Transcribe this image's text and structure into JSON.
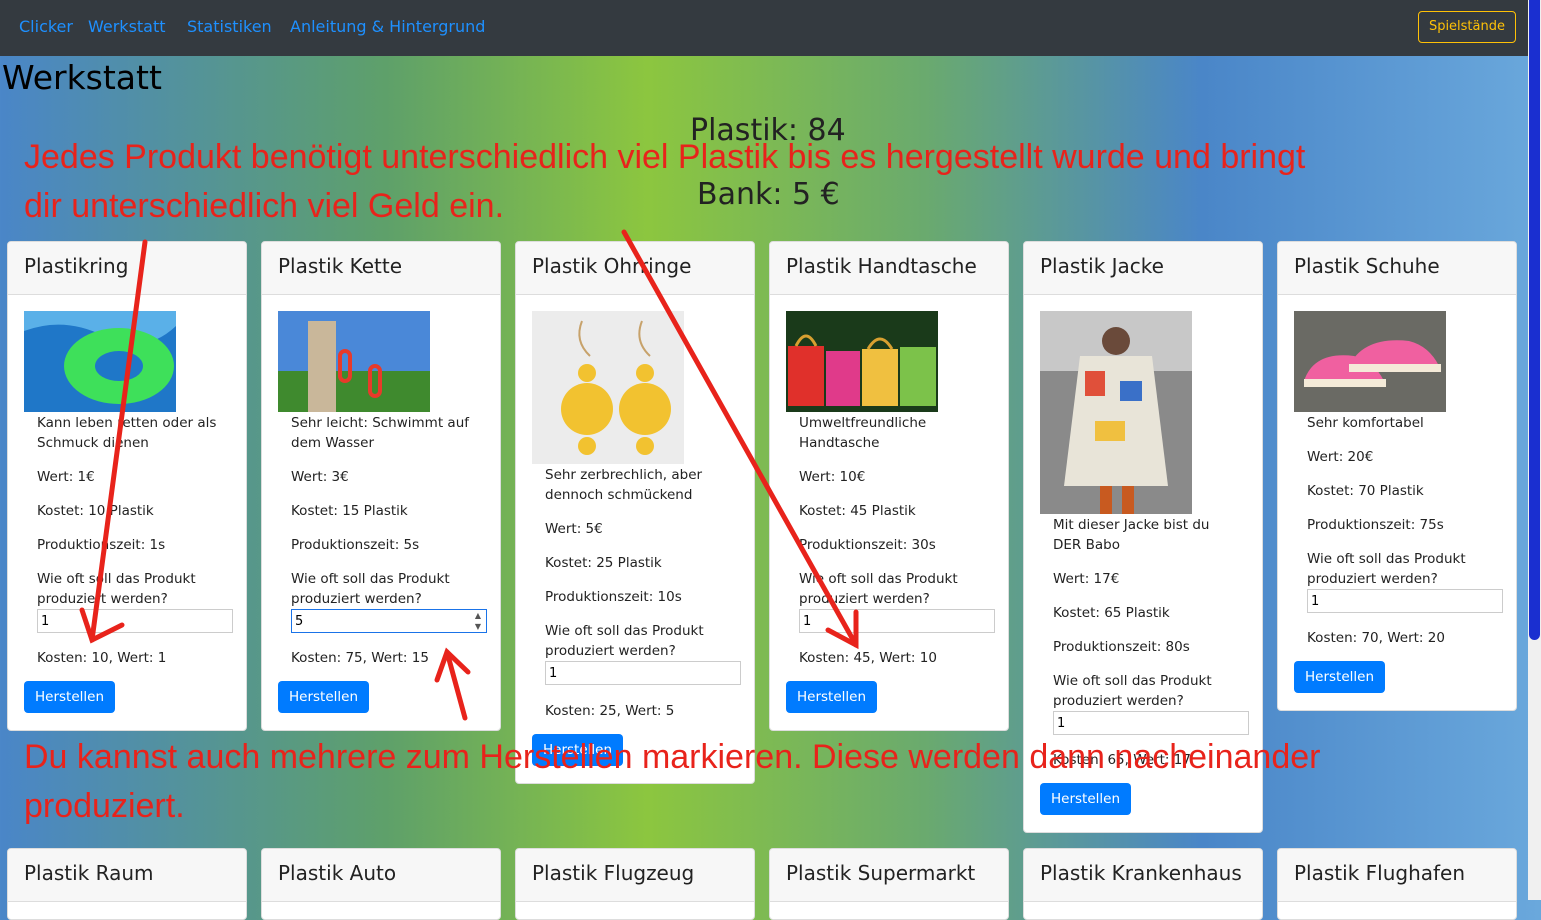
{
  "nav": {
    "links": [
      "Clicker",
      "Werkstatt",
      "Statistiken",
      "Anleitung & Hintergrund"
    ],
    "save_button": "Spielstände"
  },
  "page": {
    "title": "Werkstatt",
    "plastik": "Plastik: 84",
    "bank": "Bank: 5 €"
  },
  "annotations": {
    "top_line1": "Jedes Produkt benötigt unterschiedlich viel Plastik bis es hergestellt wurde und bringt",
    "top_line2": "dir unterschiedlich viel Geld ein.",
    "bottom_line1": "Du kannst auch mehrere zum Herstellen markieren. Diese werden dann nacheinander",
    "bottom_line2": "produziert."
  },
  "labels": {
    "question": "Wie oft soll das Produkt produziert werden?",
    "button": "Herstellen"
  },
  "products": [
    {
      "name": "Plastikring",
      "desc": "Kann leben retten oder als Schmuck dienen",
      "wert": "Wert: 1€",
      "kostet": "Kostet: 10 Plastik",
      "zeit": "Produktionszeit: 1s",
      "qty": "1",
      "summary": "Kosten: 10, Wert: 1",
      "image": "swim-ring-photo"
    },
    {
      "name": "Plastik Kette",
      "desc": "Sehr leicht: Schwimmt auf dem Wasser",
      "wert": "Wert: 3€",
      "kostet": "Kostet: 15 Plastik",
      "zeit": "Produktionszeit: 5s",
      "qty": "5",
      "summary": "Kosten: 75, Wert: 15",
      "image": "chain-photo"
    },
    {
      "name": "Plastik Ohrringe",
      "desc": "Sehr zerbrechlich, aber dennoch schmückend",
      "wert": "Wert: 5€",
      "kostet": "Kostet: 25 Plastik",
      "zeit": "Produktionszeit: 10s",
      "qty": "1",
      "summary": "Kosten: 25, Wert: 5",
      "image": "earrings-photo"
    },
    {
      "name": "Plastik Handtasche",
      "desc": "Umweltfreundliche Handtasche",
      "wert": "Wert: 10€",
      "kostet": "Kostet: 45 Plastik",
      "zeit": "Produktionszeit: 30s",
      "qty": "1",
      "summary": "Kosten: 45, Wert: 10",
      "image": "handbag-photo"
    },
    {
      "name": "Plastik Jacke",
      "desc": "Mit dieser Jacke bist du DER Babo",
      "wert": "Wert: 17€",
      "kostet": "Kostet: 65 Plastik",
      "zeit": "Produktionszeit: 80s",
      "qty": "1",
      "summary": "Kosten: 65, Wert: 17",
      "image": "jacket-photo"
    },
    {
      "name": "Plastik Schuhe",
      "desc": "Sehr komfortabel",
      "wert": "Wert: 20€",
      "kostet": "Kostet: 70 Plastik",
      "zeit": "Produktionszeit: 75s",
      "qty": "1",
      "summary": "Kosten: 70, Wert: 20",
      "image": "shoes-photo"
    }
  ],
  "products_row2": [
    "Plastik Raum",
    "Plastik Auto",
    "Plastik Flugzeug",
    "Plastik Supermarkt",
    "Plastik Krankenhaus",
    "Plastik Flughafen"
  ],
  "colors": {
    "primary": "#007bff",
    "navbar": "#343a40",
    "annotation": "#e8231b",
    "warning": "#ffc107"
  }
}
